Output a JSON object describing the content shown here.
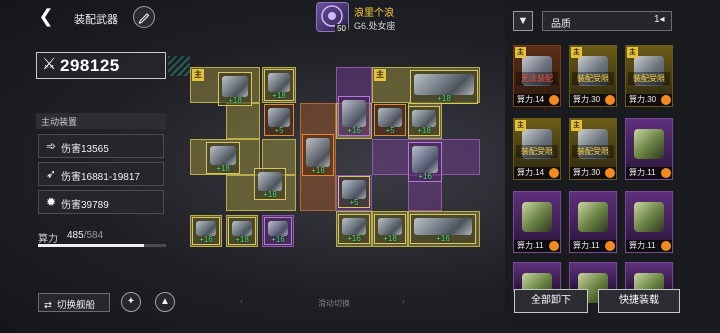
{
  "header": {
    "back_icon": "back-arrow-icon",
    "title": "装配武器",
    "rename_icon": "pencil-icon",
    "ship": {
      "name": "浪里个浪",
      "subtitle": "G6.处女座",
      "level": "50"
    }
  },
  "left": {
    "power_value": "298125",
    "section_title": "主动装置",
    "stats": [
      {
        "icon": "wing-icon",
        "text": "伤害13565"
      },
      {
        "icon": "missile-icon",
        "text": "伤害16881-19817"
      },
      {
        "icon": "burst-icon",
        "text": "伤害39789"
      }
    ],
    "capacity": {
      "label": "算力",
      "used": "485",
      "max": "584",
      "fraction": 0.83
    },
    "switch_label": "切换舰船",
    "swipe_hint": "滑动切换"
  },
  "grid_items": [
    {
      "level": "+18",
      "main": true
    },
    {
      "level": "+18",
      "main": false
    },
    {
      "level": "+5",
      "main": false
    },
    {
      "level": "+16",
      "main": false
    },
    {
      "level": "+18",
      "main": true
    },
    {
      "level": "+5",
      "main": false
    },
    {
      "level": "+18",
      "main": false
    },
    {
      "level": "+18",
      "main": false
    },
    {
      "level": "+18",
      "main": false
    },
    {
      "level": "+5",
      "main": false
    },
    {
      "level": "+16",
      "main": false
    },
    {
      "level": "+16",
      "main": false
    },
    {
      "level": "+16",
      "main": false
    },
    {
      "level": "+18",
      "main": false
    },
    {
      "level": "+18",
      "main": false
    },
    {
      "level": "+16",
      "main": false
    },
    {
      "level": "+18",
      "main": false
    },
    {
      "level": "+16",
      "main": false
    }
  ],
  "right": {
    "sort_label": "品质",
    "inventory": [
      {
        "power": "算力.14",
        "warning": "无法装配",
        "warn_color": "red",
        "main": true,
        "tint": "red"
      },
      {
        "power": "算力.30",
        "warning": "装配受限",
        "warn_color": "yellow",
        "main": true,
        "tint": "gold"
      },
      {
        "power": "算力.30",
        "warning": "装配受限",
        "warn_color": "yellow",
        "main": true,
        "tint": "gold"
      },
      {
        "power": "算力.14",
        "warning": "装配受限",
        "warn_color": "yellow",
        "main": true,
        "tint": "gold"
      },
      {
        "power": "算力.30",
        "warning": "装配受限",
        "warn_color": "yellow",
        "main": true,
        "tint": "gold"
      },
      {
        "power": "算力.11",
        "warning": "",
        "warn_color": "",
        "main": false,
        "tint": "purple"
      },
      {
        "power": "算力.11",
        "warning": "",
        "warn_color": "",
        "main": false,
        "tint": "purple"
      },
      {
        "power": "算力.11",
        "warning": "",
        "warn_color": "",
        "main": false,
        "tint": "purple"
      },
      {
        "power": "算力.11",
        "warning": "",
        "warn_color": "",
        "main": false,
        "tint": "purple"
      },
      {
        "power": "",
        "warning": "",
        "warn_color": "",
        "main": false,
        "tint": "purple"
      },
      {
        "power": "",
        "warning": "",
        "warn_color": "",
        "main": false,
        "tint": "purple"
      },
      {
        "power": "",
        "warning": "",
        "warn_color": "",
        "main": false,
        "tint": "purple"
      }
    ],
    "unload_all": "全部卸下",
    "quick_equip": "快捷装载"
  },
  "colors": {
    "accent_yellow": "#e2c23e",
    "level_green": "#4be27a",
    "warn_red": "#ff4a3a"
  }
}
